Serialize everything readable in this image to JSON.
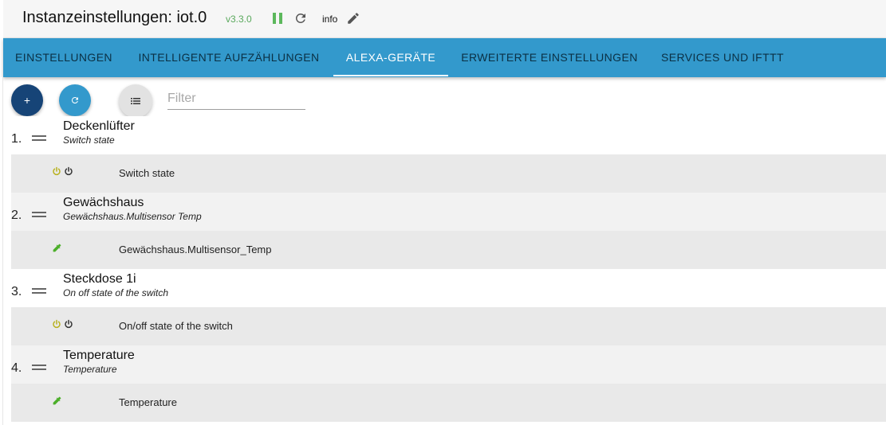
{
  "header": {
    "title": "Instanzeinstellungen: iot.0",
    "version": "v3.3.0",
    "info_label": "info"
  },
  "tabs": [
    {
      "label": "EINSTELLUNGEN",
      "active": false
    },
    {
      "label": "INTELLIGENTE AUFZÄHLUNGEN",
      "active": false
    },
    {
      "label": "ALEXA-GERÄTE",
      "active": true
    },
    {
      "label": "ERWEITERTE EINSTELLUNGEN",
      "active": false
    },
    {
      "label": "SERVICES UND IFTTT",
      "active": false
    }
  ],
  "toolbar": {
    "add_label": "+",
    "filter_placeholder": "Filter"
  },
  "devices": [
    {
      "number": "1.",
      "name": "Deckenlüfter",
      "description": "Switch state",
      "state_icons": [
        "power-icon-yellow",
        "power-icon-dark"
      ],
      "state_label": "Switch state"
    },
    {
      "number": "2.",
      "name": "Gewächshaus",
      "description": "Gewächshaus.Multisensor Temp",
      "state_icons": [
        "dropper-icon-green"
      ],
      "state_label": "Gewächshaus.Multisensor_Temp"
    },
    {
      "number": "3.",
      "name": "Steckdose 1i",
      "description": "On off state of the switch",
      "state_icons": [
        "power-icon-yellow",
        "power-icon-dark"
      ],
      "state_label": "On/off state of the switch"
    },
    {
      "number": "4.",
      "name": "Temperature",
      "description": "Temperature",
      "state_icons": [
        "dropper-icon-green"
      ],
      "state_label": "Temperature"
    }
  ],
  "colors": {
    "tab_bar": "#3399cc",
    "version_green": "#5aa95d",
    "pause_green": "#5cb85c",
    "add_button": "#164477",
    "power_yellow": "#b8b11e",
    "dropper_green": "#4caf2a"
  }
}
